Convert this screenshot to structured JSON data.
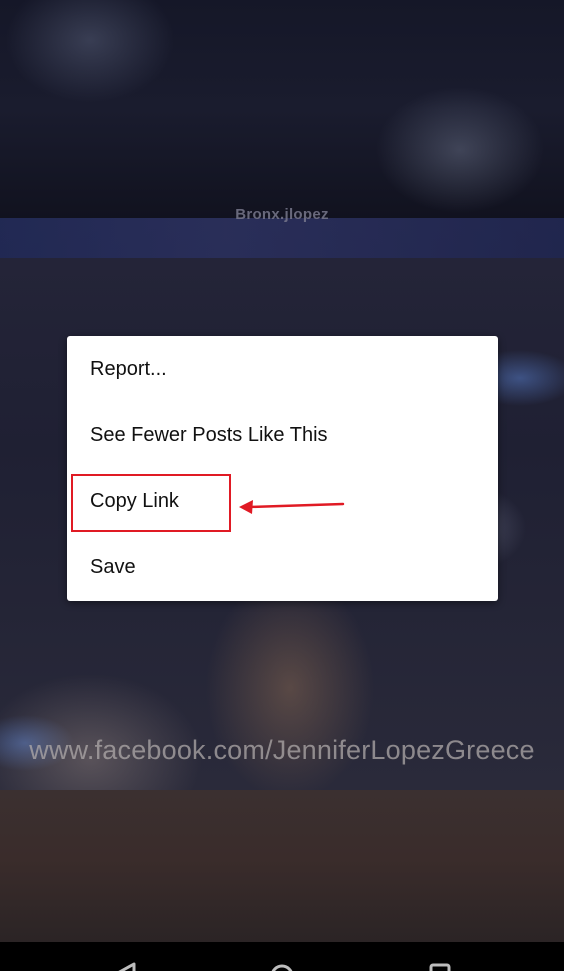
{
  "background": {
    "watermark_top": "Bronx.jlopez",
    "watermark_bottom": "www.facebook.com/JenniferLopezGreece"
  },
  "menu": {
    "items": [
      {
        "label": "Report..."
      },
      {
        "label": "See Fewer Posts Like This"
      },
      {
        "label": "Copy Link"
      },
      {
        "label": "Save"
      }
    ]
  },
  "annotation": {
    "highlight_color": "#e01a24",
    "highlighted_item": "Copy Link"
  },
  "navbar": {
    "icons": [
      "back-icon",
      "home-icon",
      "recent-apps-icon"
    ]
  }
}
